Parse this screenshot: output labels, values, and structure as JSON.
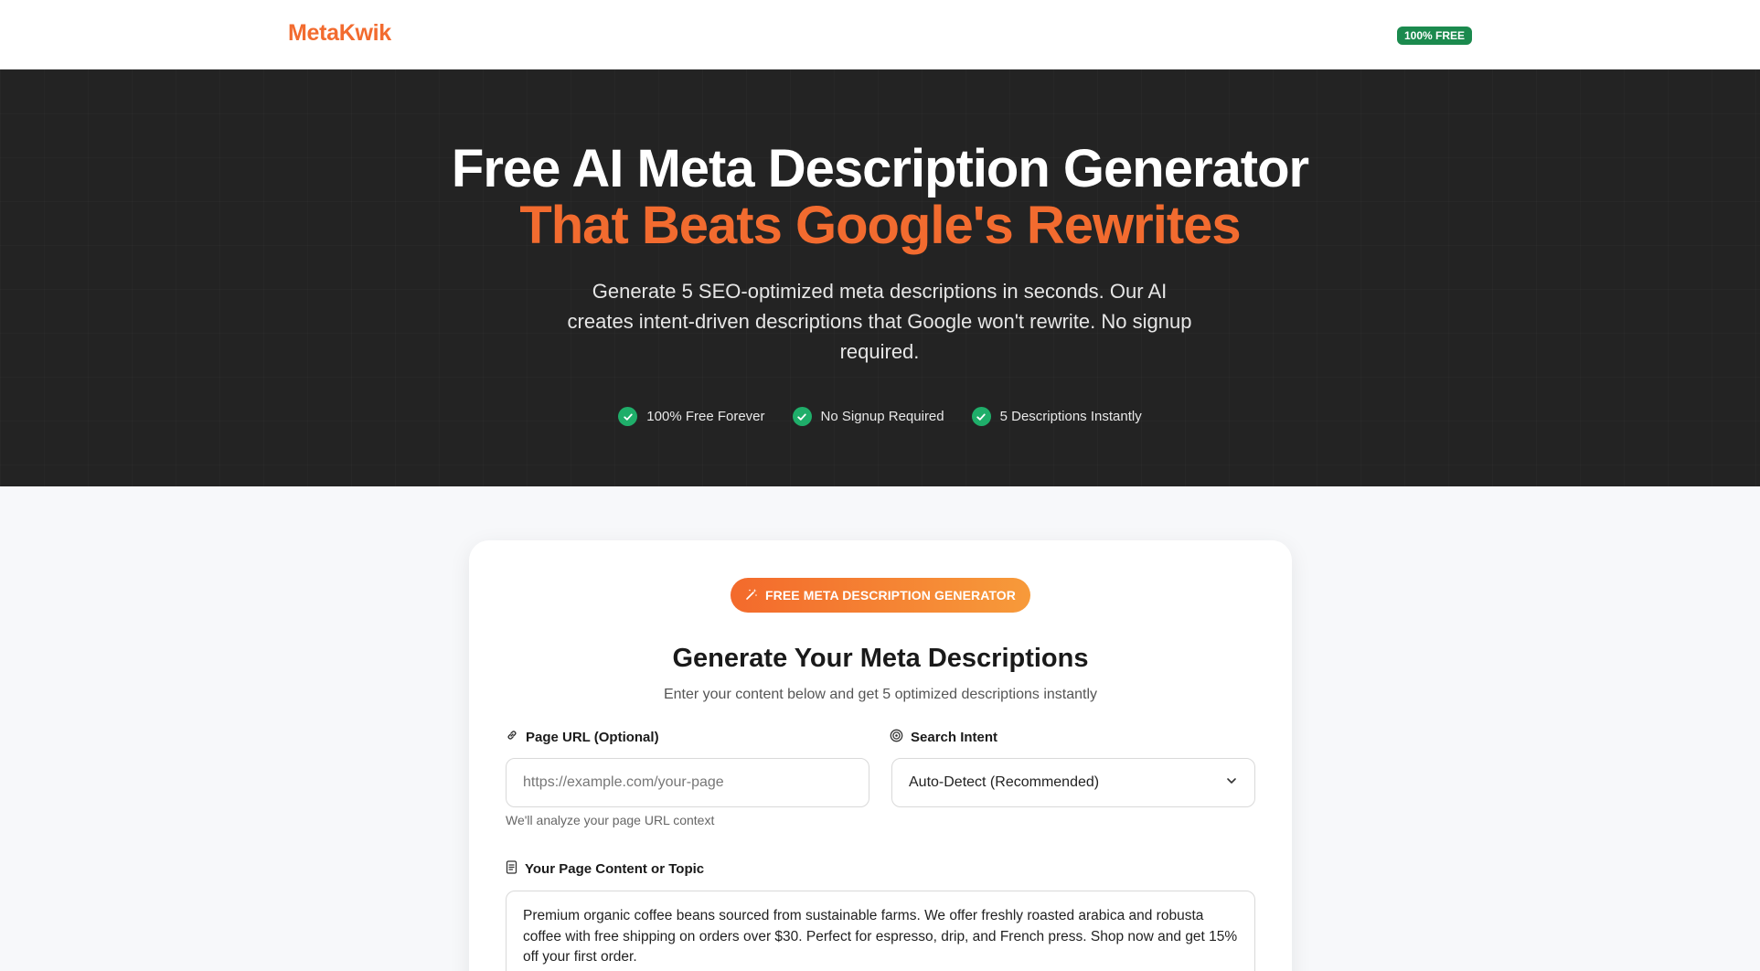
{
  "header": {
    "logo": "MetaKwik",
    "badge": "100% FREE"
  },
  "hero": {
    "title_line1": "Free AI Meta Description Generator",
    "title_line2": "That Beats Google's Rewrites",
    "subtitle": "Generate 5 SEO-optimized meta descriptions in seconds. Our AI creates intent-driven descriptions that Google won't rewrite. No signup required.",
    "checks": [
      {
        "icon": "check-circle-icon",
        "label": "100% Free Forever"
      },
      {
        "icon": "check-circle-icon",
        "label": "No Signup Required"
      },
      {
        "icon": "check-circle-icon",
        "label": "5 Descriptions Instantly"
      }
    ]
  },
  "card": {
    "pill_icon": "magic-wand-icon",
    "pill_label": "FREE META DESCRIPTION GENERATOR",
    "title": "Generate Your Meta Descriptions",
    "subtitle": "Enter your content below and get 5 optimized descriptions instantly",
    "url_field": {
      "icon": "link-icon",
      "label": "Page URL (Optional)",
      "placeholder": "https://example.com/your-page",
      "value": "",
      "helper": "We'll analyze your page URL context"
    },
    "intent_field": {
      "icon": "target-icon",
      "label": "Search Intent",
      "selected": "Auto-Detect (Recommended)"
    },
    "content_field": {
      "icon": "document-icon",
      "label": "Your Page Content or Topic",
      "value": "Premium organic coffee beans sourced from sustainable farms. We offer freshly roasted arabica and robusta coffee with free shipping on orders over $30. Perfect for espresso, drip, and French press. Shop now and get 15% off your first order."
    }
  },
  "colors": {
    "brand": "#f26b2f",
    "hero_bg": "#232323",
    "success": "#1fae6a",
    "badge_green": "#1b8a4e"
  }
}
